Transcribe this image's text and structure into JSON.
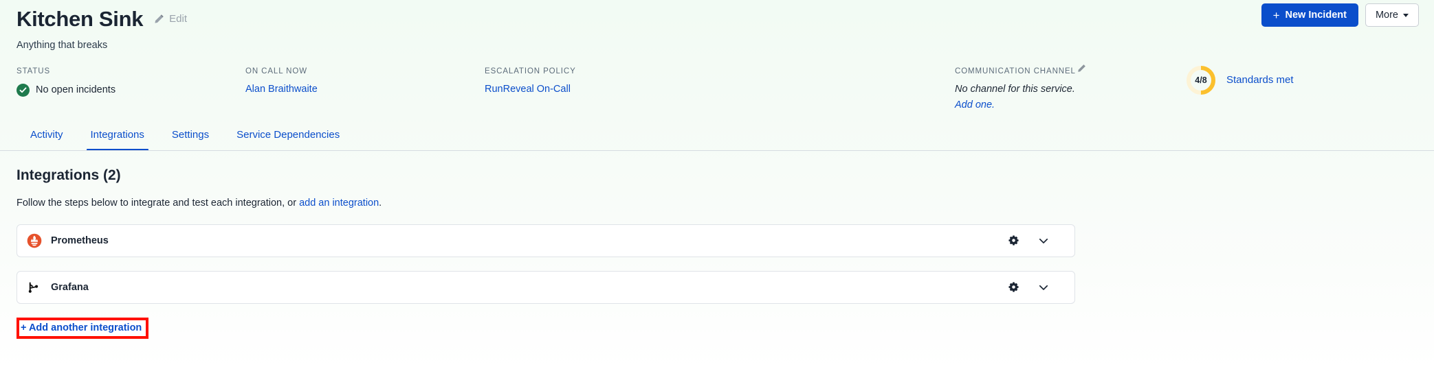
{
  "header": {
    "service_title": "Kitchen Sink",
    "edit_label": "Edit",
    "edit_icon": "pencil-icon",
    "subtitle": "Anything that breaks",
    "new_incident_label": "New Incident",
    "new_incident_plus": "+",
    "more_label": "More",
    "accent_color": "#0b4ecb"
  },
  "meta": {
    "status": {
      "label": "STATUS",
      "value": "No open incidents",
      "icon": "check-circle-icon",
      "icon_color": "#1e7a4d"
    },
    "on_call": {
      "label": "ON CALL NOW",
      "value": "Alan Braithwaite"
    },
    "escalation": {
      "label": "ESCALATION POLICY",
      "value": "RunReveal On-Call"
    },
    "channel": {
      "label": "COMMUNICATION CHANNEL",
      "edit_icon": "pencil-icon",
      "note": "No channel for this service.",
      "add_label": "Add one."
    },
    "standards": {
      "fraction": "4/8",
      "label": "Standards met",
      "met": 4,
      "total": 8,
      "arc_color": "#fbc02d",
      "track_color": "#fdf3d6"
    }
  },
  "tabs": [
    {
      "label": "Activity",
      "active": false
    },
    {
      "label": "Integrations",
      "active": true
    },
    {
      "label": "Settings",
      "active": false
    },
    {
      "label": "Service Dependencies",
      "active": false
    }
  ],
  "main": {
    "section_title": "Integrations (2)",
    "desc_before": "Follow the steps below to integrate and test each integration, or ",
    "desc_link": "add an integration",
    "desc_after": ".",
    "integrations": [
      {
        "name": "Prometheus",
        "logo": "prometheus-logo",
        "gear_icon": "gear-icon",
        "chevron_icon": "chevron-down-icon"
      },
      {
        "name": "Grafana",
        "logo": "grafana-logo",
        "gear_icon": "gear-icon",
        "chevron_icon": "chevron-down-icon"
      }
    ],
    "add_another_label": "+ Add another integration",
    "highlight_color": "#ff1100"
  }
}
